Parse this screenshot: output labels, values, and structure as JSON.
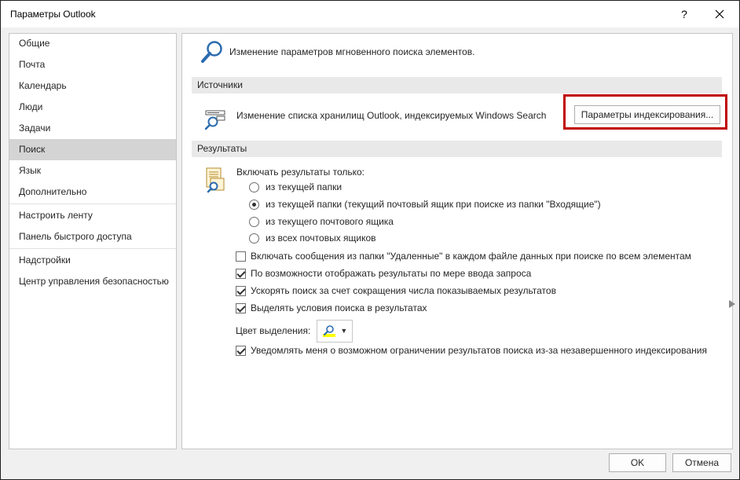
{
  "window": {
    "title": "Параметры Outlook"
  },
  "sidebar": {
    "items": [
      {
        "label": "Общие"
      },
      {
        "label": "Почта"
      },
      {
        "label": "Календарь"
      },
      {
        "label": "Люди"
      },
      {
        "label": "Задачи"
      },
      {
        "label": "Поиск",
        "active": true
      },
      {
        "label": "Язык"
      },
      {
        "label": "Дополнительно"
      },
      {
        "label": "Настроить ленту"
      },
      {
        "label": "Панель быстрого доступа"
      },
      {
        "label": "Надстройки"
      },
      {
        "label": "Центр управления безопасностью"
      }
    ]
  },
  "main": {
    "intro_text": "Изменение параметров мгновенного поиска элементов.",
    "sources": {
      "header": "Источники",
      "description": "Изменение списка хранилищ Outlook, индексируемых Windows Search",
      "button_label": "Параметры индексирования..."
    },
    "results": {
      "header": "Результаты",
      "include_label": "Включать результаты только:",
      "radios": [
        {
          "label": "из текущей папки",
          "selected": false
        },
        {
          "label": "из текущей папки (текущий почтовый ящик при поиске из папки \"Входящие\")",
          "selected": true
        },
        {
          "label": "из текущего почтового ящика",
          "selected": false
        },
        {
          "label": "из всех почтовых ящиков",
          "selected": false
        }
      ],
      "checkboxes": [
        {
          "label": "Включать сообщения из папки \"Удаленные\" в каждом файле данных при поиске по всем элементам",
          "checked": false
        },
        {
          "label": "По возможности отображать результаты по мере ввода запроса",
          "checked": true
        },
        {
          "label": "Ускорять поиск за счет сокращения числа показываемых результатов",
          "checked": true
        },
        {
          "label": "Выделять условия поиска в результатах",
          "checked": true
        }
      ],
      "highlight_color_label": "Цвет выделения:",
      "highlight_color": "#ffff00",
      "notify_checkbox": {
        "label": "Уведомлять меня о возможном ограничении результатов поиска из-за незавершенного индексирования",
        "checked": true
      }
    }
  },
  "footer": {
    "ok_label": "OK",
    "cancel_label": "Отмена"
  },
  "icons": {
    "help": "question-mark-icon",
    "close": "close-icon",
    "intro": "search-magnifier-icon",
    "sources": "search-drive-icon",
    "results": "search-document-icon",
    "color": "highlight-pen-icon"
  }
}
